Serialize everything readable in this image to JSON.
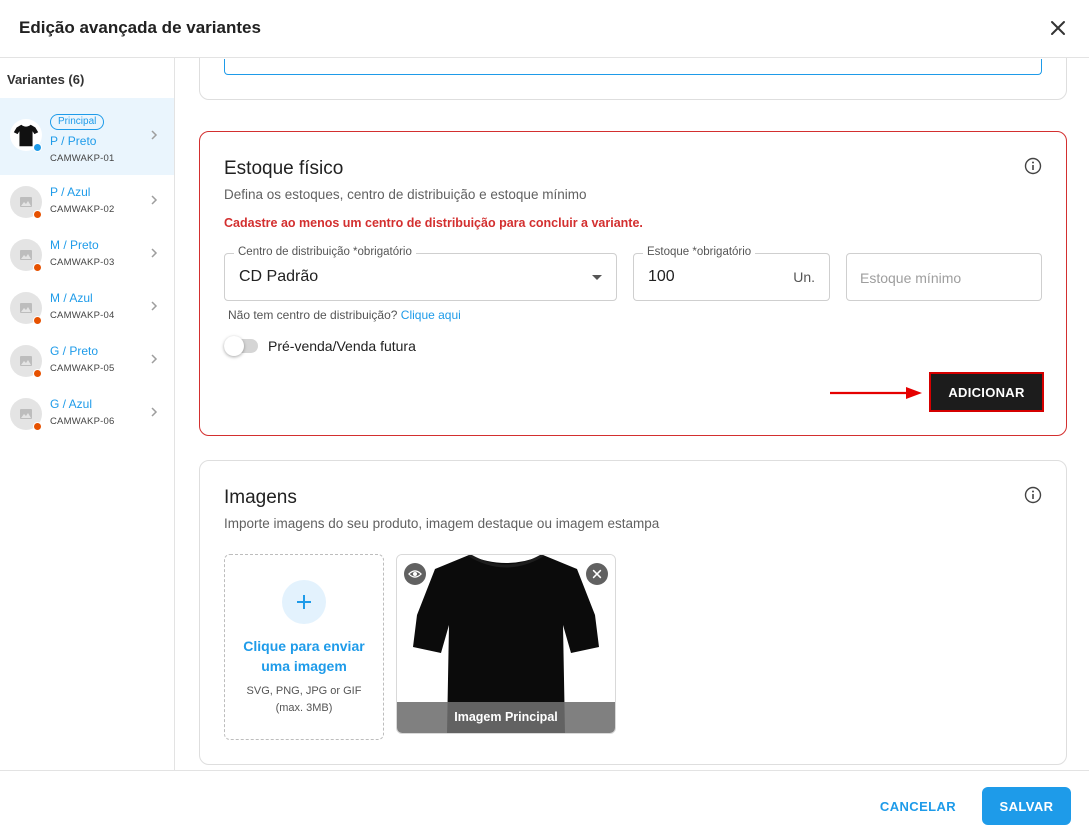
{
  "modal": {
    "title": "Edição avançada de variantes"
  },
  "sidebar": {
    "title": "Variantes (6)",
    "principal_badge": "Principal",
    "items": [
      {
        "name": "P / Preto",
        "sku": "CAMWAKP-01",
        "status_color": "#1e9be9"
      },
      {
        "name": "P / Azul",
        "sku": "CAMWAKP-02",
        "status_color": "#e65100"
      },
      {
        "name": "M / Preto",
        "sku": "CAMWAKP-03",
        "status_color": "#e65100"
      },
      {
        "name": "M / Azul",
        "sku": "CAMWAKP-04",
        "status_color": "#e65100"
      },
      {
        "name": "G / Preto",
        "sku": "CAMWAKP-05",
        "status_color": "#e65100"
      },
      {
        "name": "G / Azul",
        "sku": "CAMWAKP-06",
        "status_color": "#e65100"
      }
    ]
  },
  "stock": {
    "title": "Estoque físico",
    "subtitle": "Defina os estoques, centro de distribuição e estoque mínimo",
    "error": "Cadastre ao menos um centro de distribuição para concluir a variante.",
    "dc_label": "Centro de distribuição *obrigatório",
    "dc_value": "CD Padrão",
    "qty_label": "Estoque *obrigatório",
    "qty_value": "100",
    "qty_suffix": "Un.",
    "min_placeholder": "Estoque mínimo",
    "hint_text": "Não tem centro de distribuição?",
    "hint_link": "Clique aqui",
    "presale_label": "Pré-venda/Venda futura",
    "add_button": "ADICIONAR"
  },
  "images": {
    "title": "Imagens",
    "subtitle": "Importe imagens do seu produto, imagem destaque ou imagem estampa",
    "upload_line1": "Clique para enviar",
    "upload_line2": "uma imagem",
    "upload_hint1": "SVG, PNG, JPG or GIF",
    "upload_hint2": "(max. 3MB)",
    "image_caption": "Imagem Principal"
  },
  "footer": {
    "cancel": "CANCELAR",
    "save": "SALVAR"
  },
  "colors": {
    "accent": "#1e9be9",
    "error": "#d32f2f",
    "pending_dot": "#e65100"
  }
}
